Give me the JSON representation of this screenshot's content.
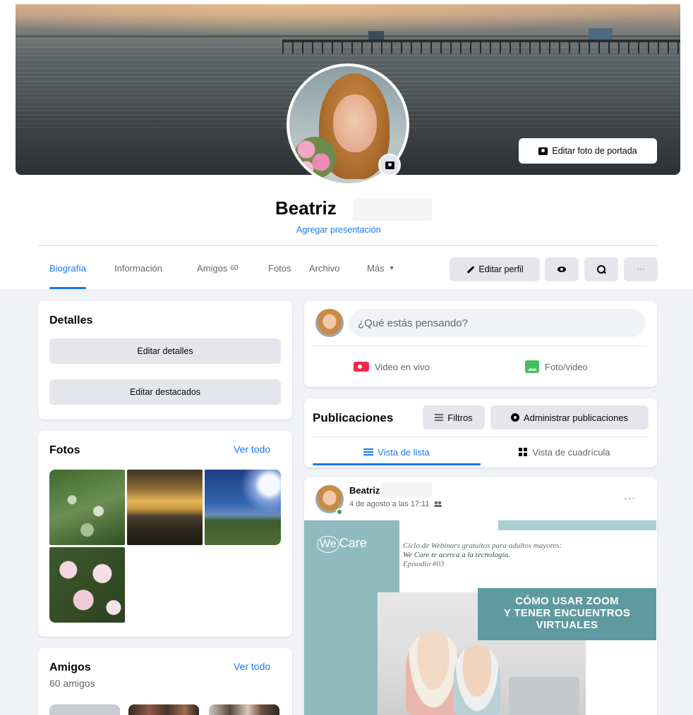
{
  "profile": {
    "name": "Beatriz",
    "add_intro": "Agregar presentación",
    "edit_cover": "Editar foto de portada"
  },
  "tabs": [
    {
      "label": "Biografía",
      "active": true
    },
    {
      "label": "Información"
    },
    {
      "label": "Amigos",
      "count": "60"
    },
    {
      "label": "Fotos"
    },
    {
      "label": "Archivo"
    },
    {
      "label": "Más"
    }
  ],
  "actions": {
    "edit_profile": "Editar perfil",
    "more_dots": "···"
  },
  "details": {
    "title": "Detalles",
    "edit_details": "Editar detalles",
    "edit_featured": "Editar destacados"
  },
  "photos": {
    "title": "Fotos",
    "see_all": "Ver todo"
  },
  "friends": {
    "title": "Amigos",
    "see_all": "Ver todo",
    "count_label": "60 amigos"
  },
  "composer": {
    "placeholder": "¿Qué estás pensando?",
    "live_video": "Video en vivo",
    "photo_video": "Foto/video"
  },
  "posts_section": {
    "title": "Publicaciones",
    "filters": "Filtros",
    "manage": "Administrar publicaciones",
    "list_view": "Vista de lista",
    "grid_view": "Vista de cuadrícula"
  },
  "post": {
    "author": "Beatriz",
    "timestamp": "4 de agosto a las 17:11",
    "more": "···",
    "image": {
      "logo": "WeCare",
      "logo_we": "We",
      "logo_care": "Care",
      "line1": "Ciclo de Webinars gratuitos para adultos mayores:",
      "line2": "We Care te acerca a la tecnología.",
      "line3": "Episodio #03",
      "banner_line1": "CÓMO USAR ZOOM",
      "banner_line2": "Y TENER ENCUENTROS",
      "banner_line3": "VIRTUALES"
    }
  },
  "colors": {
    "accent": "#1877f2",
    "background": "#f0f2f5",
    "button_grey": "#e4e6eb",
    "secondary_text": "#65676b",
    "live_red": "#f02849",
    "photo_green": "#45bd62",
    "online_green": "#31a24c",
    "teal": "#5f9aa0"
  }
}
